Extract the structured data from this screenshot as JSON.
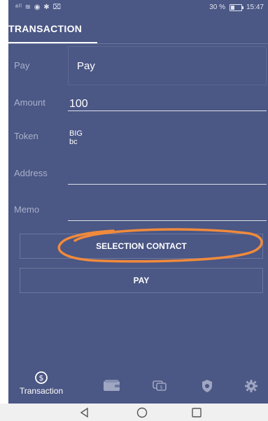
{
  "statusbar": {
    "left": "ᵃˡˡ ≋ ◉ ✱ ⌧",
    "battery_pct": "30 %",
    "time": "15:47"
  },
  "tabs": [
    {
      "label": "TRANSACTION",
      "active": true
    }
  ],
  "form": {
    "pay": {
      "label": "Pay",
      "value": "Pay"
    },
    "amount": {
      "label": "Amount",
      "value": "100"
    },
    "token": {
      "label": "Token",
      "value_line1": "BIG",
      "value_line2": "bc"
    },
    "address": {
      "label": "Address",
      "value": ""
    },
    "memo": {
      "label": "Memo",
      "value": ""
    }
  },
  "buttons": {
    "selection_contact": "SELECTION CONTACT",
    "pay": "PAY"
  },
  "bottom_nav": {
    "items": [
      {
        "label": "Transaction",
        "icon": "dollar-circle-icon",
        "active": true
      },
      {
        "label": "",
        "icon": "wallet-icon",
        "active": false
      },
      {
        "label": "",
        "icon": "exchange-icon",
        "active": false
      },
      {
        "label": "",
        "icon": "shield-icon",
        "active": false
      },
      {
        "label": "",
        "icon": "gear-icon",
        "active": false
      }
    ]
  },
  "colors": {
    "background": "#4b5784",
    "accent_annotation": "#f08a3c",
    "text": "#ffffff",
    "label": "#aab1cc"
  }
}
